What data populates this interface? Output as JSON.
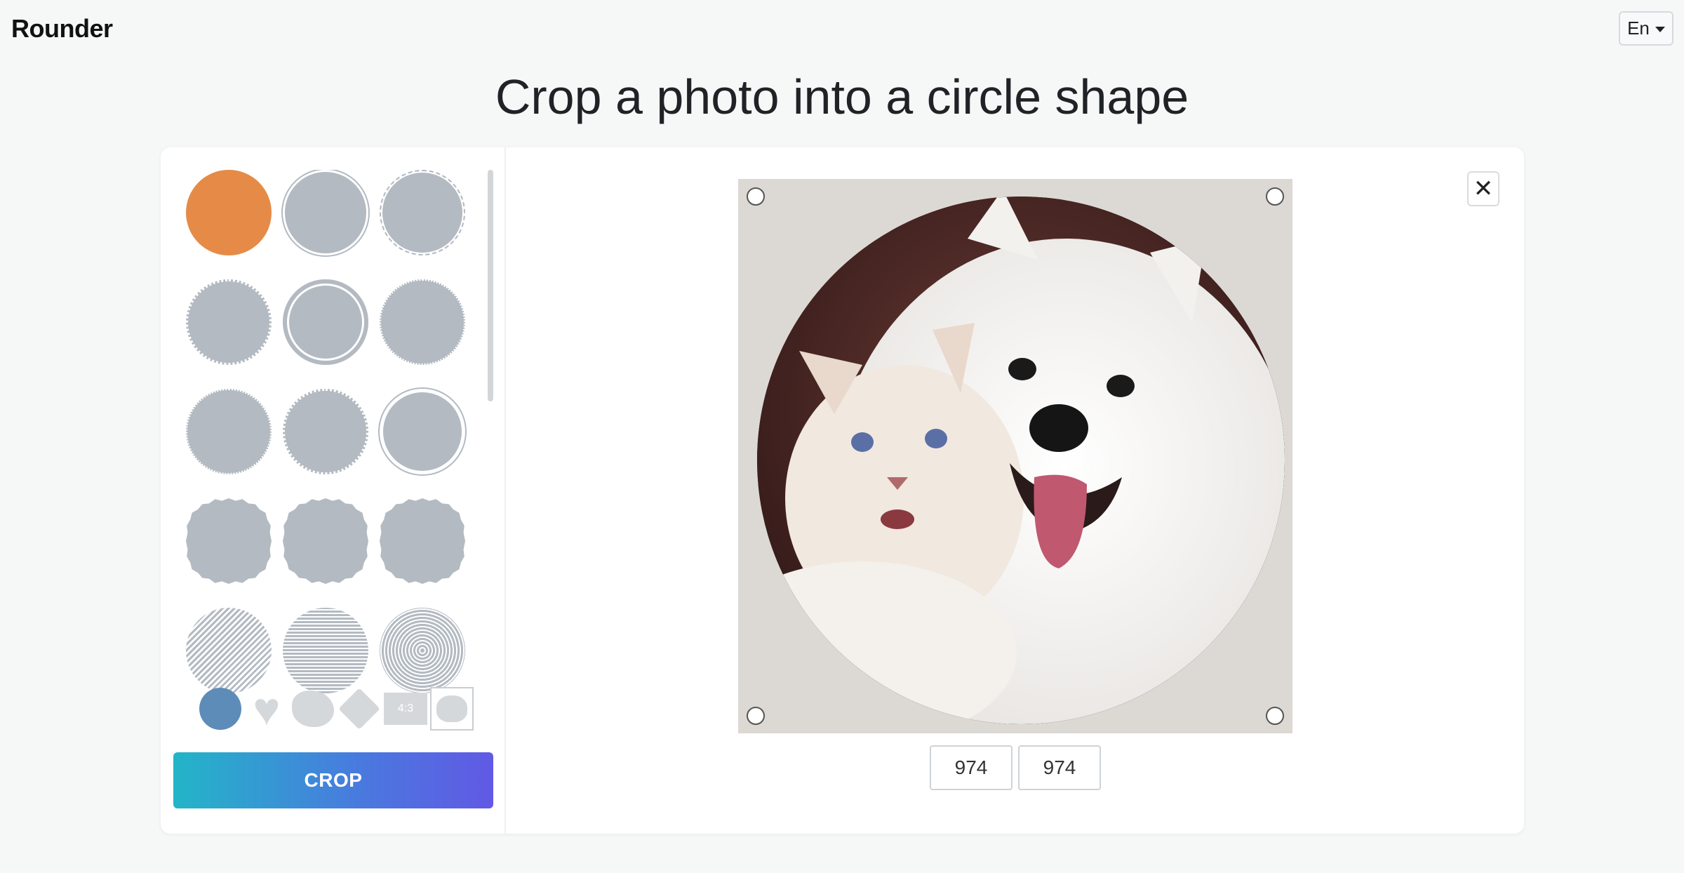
{
  "header": {
    "brand": "Rounder",
    "lang": "En"
  },
  "page": {
    "title": "Crop a photo into a circle shape"
  },
  "shapes": {
    "items": [
      {
        "name": "shape-solid",
        "selected": true
      },
      {
        "name": "shape-ring"
      },
      {
        "name": "shape-dashed-ring"
      },
      {
        "name": "shape-heart-dots"
      },
      {
        "name": "shape-double-ring"
      },
      {
        "name": "shape-dotted-ring"
      },
      {
        "name": "shape-fine-dots"
      },
      {
        "name": "shape-dot-border"
      },
      {
        "name": "shape-thin-ring"
      },
      {
        "name": "shape-scalloped"
      },
      {
        "name": "shape-scalloped-small"
      },
      {
        "name": "shape-serrated"
      },
      {
        "name": "shape-hatched"
      },
      {
        "name": "shape-lined"
      },
      {
        "name": "shape-concentric"
      }
    ]
  },
  "types": {
    "ratio_label": "4:3"
  },
  "actions": {
    "crop_label": "CROP"
  },
  "output": {
    "width": "974",
    "height": "974"
  },
  "colors": {
    "selected_shape": "#e58b47",
    "shape": "#b3bac2",
    "active_type": "#5e8cb8"
  }
}
